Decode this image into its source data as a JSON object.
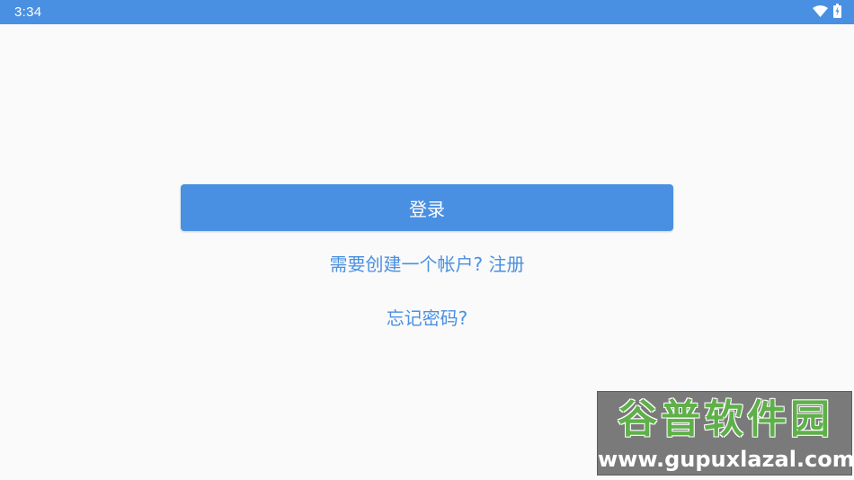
{
  "status_bar": {
    "time": "3:34",
    "icons": [
      "wifi-icon",
      "battery-icon"
    ],
    "color": "#4a90e2"
  },
  "login": {
    "button_label": "登录",
    "register_prompt": "需要创建一个帐户? 注册",
    "forgot_password": "忘记密码?"
  },
  "watermark": {
    "title": "谷普软件园",
    "url": "www.gupuxlazal.com"
  },
  "colors": {
    "accent": "#4a90e2",
    "background": "#fafafa"
  }
}
